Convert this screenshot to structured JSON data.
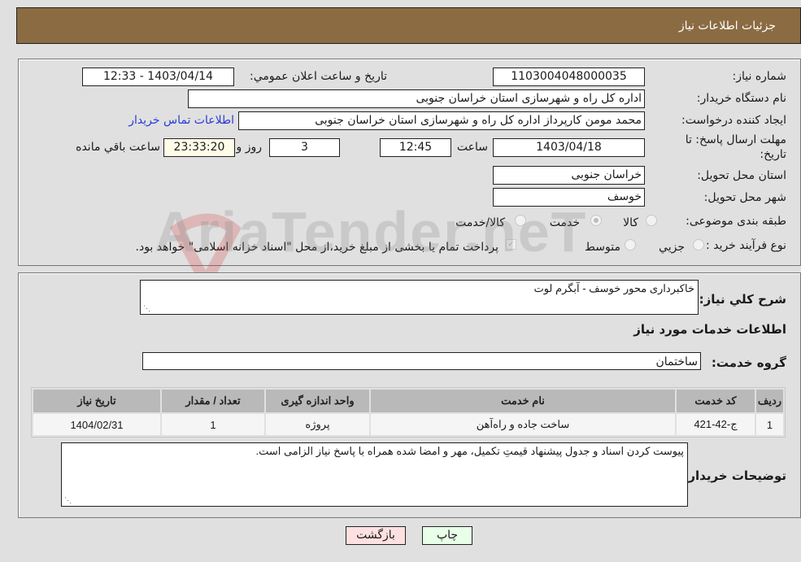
{
  "header": {
    "title": "جزئیات اطلاعات نیاز"
  },
  "form": {
    "need_number": {
      "label": "شماره نیاز:",
      "value": "1103004048000035"
    },
    "announce_datetime": {
      "label": "تاريخ و ساعت اعلان عمومي:",
      "value": "1403/04/14 - 12:33"
    },
    "buyer_org": {
      "label": "نام دستگاه خريدار:",
      "value": "اداره کل راه و شهرسازی استان خراسان جنوبی"
    },
    "requester": {
      "label": "ايجاد کننده درخواست:",
      "value": "محمد مومن کارپرداز اداره کل راه و شهرسازی استان خراسان جنوبی"
    },
    "buyer_contact_link": "اطلاعات تماس خريدار",
    "deadline": {
      "label_line1": "مهلت ارسال پاسخ: تا",
      "label_line2": "تاريخ:",
      "date": "1403/04/18",
      "time_label": "ساعت",
      "time": "12:45",
      "days": "3",
      "days_label": "روز و",
      "remaining": "23:33:20",
      "remaining_label": "ساعت باقي مانده"
    },
    "delivery_province": {
      "label": "استان محل تحویل:",
      "value": "خراسان جنوبی"
    },
    "delivery_city": {
      "label": "شهر محل تحویل:",
      "value": "خوسف"
    },
    "category": {
      "label": "طبقه بندی موضوعی:",
      "options": [
        "کالا",
        "خدمت",
        "کالا/خدمت"
      ],
      "selected": "خدمت"
    },
    "purchase_type": {
      "label": "نوع فرآيند خريد :",
      "options": [
        "جزيي",
        "متوسط"
      ],
      "selected": "متوسط",
      "treasury_note": "پرداخت تمام يا بخشی از مبلغ خريد،از محل \"اسناد خزانه اسلامی\" خواهد بود."
    }
  },
  "details": {
    "summary_label": "شرح کلي نياز:",
    "summary_value": "خاکبرداری محور خوسف - آبگرم لوت",
    "services_heading": "اطلاعات خدمات مورد نياز",
    "service_group_label": "گروه خدمت:",
    "service_group_value": "ساختمان",
    "table": {
      "headers": [
        "رديف",
        "کد خدمت",
        "نام خدمت",
        "واحد اندازه گيری",
        "تعداد / مقدار",
        "تاريخ نياز"
      ],
      "rows": [
        [
          "1",
          "ج-42-421",
          "ساخت جاده و راه‌آهن",
          "پروژه",
          "1",
          "1404/02/31"
        ]
      ]
    },
    "buyer_notes_label": "توضيحات خريدار:",
    "buyer_notes_value": "پیوست کردن اسناد و جدول پیشنهاد قیمتِ تکمیل، مهر و امضا شده همراه با پاسخ نیاز الزامی است."
  },
  "buttons": {
    "print": "چاپ",
    "back": "بازگشت"
  },
  "watermark": "AriaTender.neT"
}
